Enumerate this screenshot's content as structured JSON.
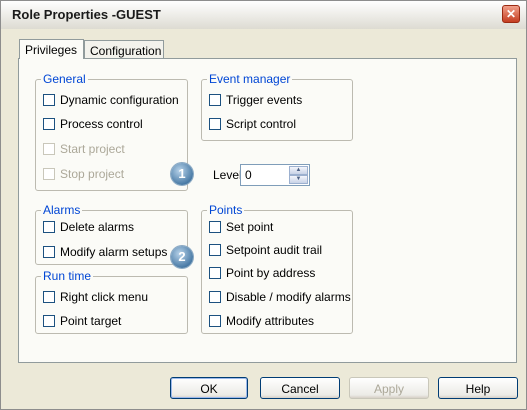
{
  "window": {
    "title": "Role Properties -GUEST",
    "close_glyph": "✕"
  },
  "tabs": [
    {
      "label": "Privileges",
      "active": true
    },
    {
      "label": "Configuration",
      "active": false
    }
  ],
  "groups": {
    "general": {
      "title": "General",
      "items": [
        {
          "label": "Dynamic configuration",
          "checked": false,
          "enabled": true
        },
        {
          "label": "Process control",
          "checked": false,
          "enabled": true
        },
        {
          "label": "Start project",
          "checked": false,
          "enabled": false
        },
        {
          "label": "Stop project",
          "checked": false,
          "enabled": false
        }
      ]
    },
    "event_manager": {
      "title": "Event manager",
      "items": [
        {
          "label": "Trigger events",
          "checked": false,
          "enabled": true
        },
        {
          "label": "Script control",
          "checked": false,
          "enabled": true
        }
      ]
    },
    "alarms": {
      "title": "Alarms",
      "items": [
        {
          "label": "Delete alarms",
          "checked": false,
          "enabled": true
        },
        {
          "label": "Modify alarm setups",
          "checked": false,
          "enabled": true
        }
      ]
    },
    "run_time": {
      "title": "Run time",
      "items": [
        {
          "label": "Right click menu",
          "checked": false,
          "enabled": true
        },
        {
          "label": "Point target",
          "checked": false,
          "enabled": true
        }
      ]
    },
    "points": {
      "title": "Points",
      "items": [
        {
          "label": "Set point",
          "checked": false,
          "enabled": true
        },
        {
          "label": "Setpoint audit trail",
          "checked": false,
          "enabled": true
        },
        {
          "label": "Point by address",
          "checked": false,
          "enabled": true
        },
        {
          "label": "Disable / modify alarms",
          "checked": false,
          "enabled": true
        },
        {
          "label": "Modify attributes",
          "checked": false,
          "enabled": true
        }
      ]
    }
  },
  "level": {
    "label": "Level:",
    "value": "0"
  },
  "callouts": [
    "1",
    "2"
  ],
  "buttons": {
    "ok": "OK",
    "cancel": "Cancel",
    "apply": "Apply",
    "help": "Help"
  },
  "icons": {
    "close": "close-icon",
    "spin_up": "arrow-up-icon",
    "spin_down": "arrow-down-icon"
  },
  "colors": {
    "group_title": "#0046d5",
    "close_button": "#c43d20",
    "dialog_bg": "#ece9d8"
  }
}
